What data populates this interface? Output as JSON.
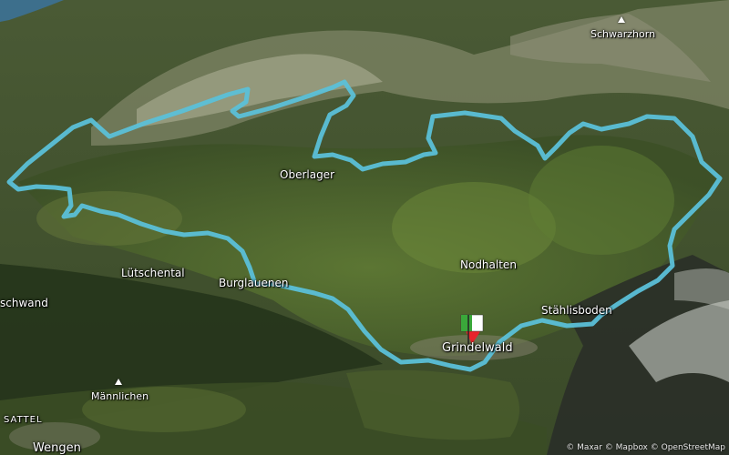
{
  "map": {
    "basemap": "satellite",
    "route_color": "#5bc0d8",
    "marker_colors": {
      "start": "#3aa83a",
      "finish": "#ffffff",
      "pin": "#e8242b"
    },
    "place_labels": [
      {
        "id": "schwarzhorn",
        "text": "Schwarzhorn",
        "icon": "peak-icon"
      },
      {
        "id": "oberlager",
        "text": "Oberlager"
      },
      {
        "id": "nodhalten",
        "text": "Nodhalten"
      },
      {
        "id": "lutschental",
        "text": "Lütschental"
      },
      {
        "id": "burglauenen",
        "text": "Burglauenen"
      },
      {
        "id": "stahlisboden",
        "text": "Stählisboden"
      },
      {
        "id": "grindelwald",
        "text": "Grindelwald"
      },
      {
        "id": "schwand",
        "text": "schwand"
      },
      {
        "id": "mannlichen",
        "text": "Männlichen",
        "icon": "peak-icon"
      },
      {
        "id": "sattel",
        "text": "SATTEL"
      },
      {
        "id": "wengen",
        "text": "Wengen"
      }
    ],
    "attribution": "© Maxar © Mapbox © OpenStreetMap"
  }
}
